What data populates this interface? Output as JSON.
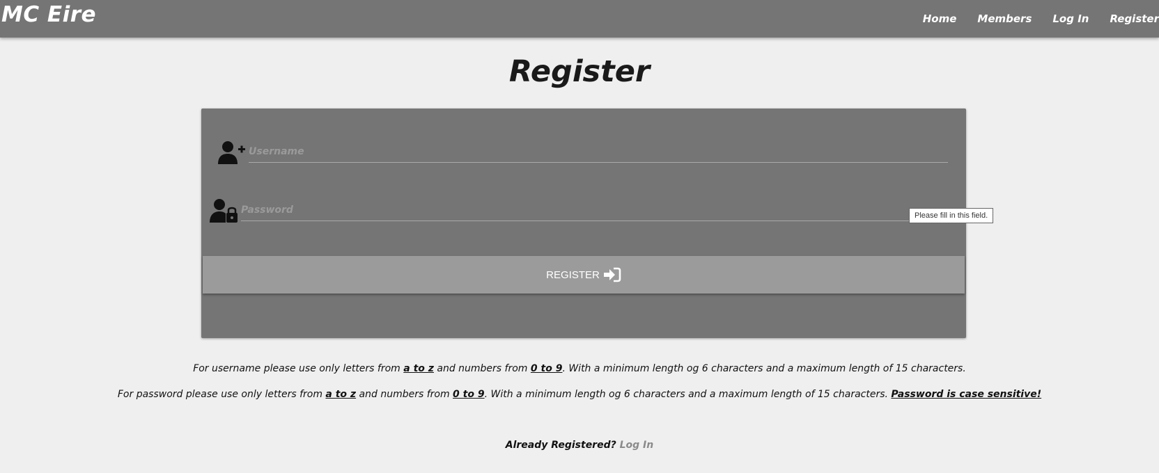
{
  "navbar": {
    "brand": "MC Eire",
    "links": [
      "Home",
      "Members",
      "Log In",
      "Register"
    ]
  },
  "page": {
    "title": "Register"
  },
  "form": {
    "username_placeholder": "Username",
    "username_value": "",
    "password_placeholder": "Password",
    "password_value": "",
    "tooltip": "Please fill in this field.",
    "submit_label": "REGISTER",
    "icons": {
      "username": "user-plus-icon",
      "password": "user-lock-icon",
      "submit": "sign-in-icon"
    }
  },
  "rules": {
    "username": {
      "p1": "For username please use only letters from ",
      "letters": "a to z",
      "p2": " and numbers from ",
      "numbers": "0 to 9",
      "p3": ". With a minimum length og 6 characters and a maximum length of 15 characters."
    },
    "password": {
      "p1": "For password please use only letters from ",
      "letters": "a to z",
      "p2": " and numbers from ",
      "numbers": "0 to 9",
      "p3": ". With a minimum length og 6 characters and a maximum length of 15 characters. ",
      "case": "Password is case sensitive!"
    }
  },
  "footer": {
    "already_text": "Already Registered? ",
    "login_link": "Log In"
  },
  "colors": {
    "navbar_bg": "#757575",
    "page_bg": "#efefef",
    "card_bg": "#757575",
    "button_bg": "#9b9b9b",
    "link_muted": "#8a8a8a"
  }
}
